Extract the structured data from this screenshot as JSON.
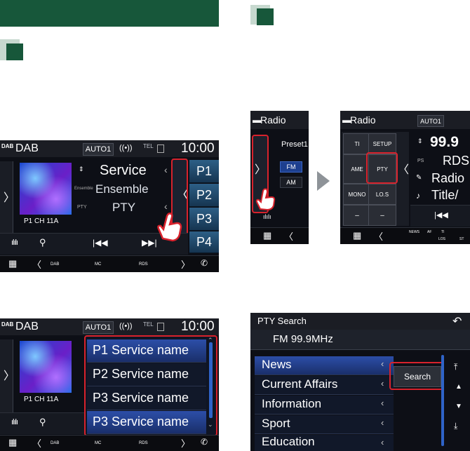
{
  "dab1": {
    "source": "DAB",
    "auto": "AUTO1",
    "tel": "TEL",
    "time": "10:00",
    "service": "Service",
    "ensemble": "Ensemble",
    "pty": "PTY",
    "ensemble_small": "Ensemble",
    "pty_small": "PTY",
    "channel": "P1  CH 11A",
    "presets": [
      "P1",
      "P2",
      "P3",
      "P4"
    ],
    "bottom": [
      "DAB",
      "MC",
      "RDS"
    ]
  },
  "dab2": {
    "source": "DAB",
    "auto": "AUTO1",
    "tel": "TEL",
    "time": "10:00",
    "channel": "P1  CH 11A",
    "list": [
      "P1  Service name",
      "P2  Service name",
      "P3  Service name",
      "P3  Service name"
    ],
    "bottom": [
      "DAB",
      "MC",
      "RDS"
    ]
  },
  "radio1": {
    "title": "Radio",
    "preset": "Preset1",
    "fm": "FM",
    "am": "AM"
  },
  "radio2": {
    "title": "Radio",
    "auto": "AUTO1",
    "ti": "TI",
    "setup": "SETUP",
    "ame": "AME",
    "pty": "PTY",
    "mono": "MONO",
    "los": "LO.S",
    "freq": "99.9",
    "ps": "PS",
    "rds": "RDS",
    "radio_text": "Radio",
    "title_text": "Title/",
    "bottom": [
      "NEWS",
      "AF",
      "TI",
      "LOS",
      "ST"
    ]
  },
  "ptysearch": {
    "title": "PTY Search",
    "freq": "FM 99.9MHz",
    "items": [
      "News",
      "Current Affairs",
      "Information",
      "Sport",
      "Education"
    ],
    "search": "Search"
  }
}
